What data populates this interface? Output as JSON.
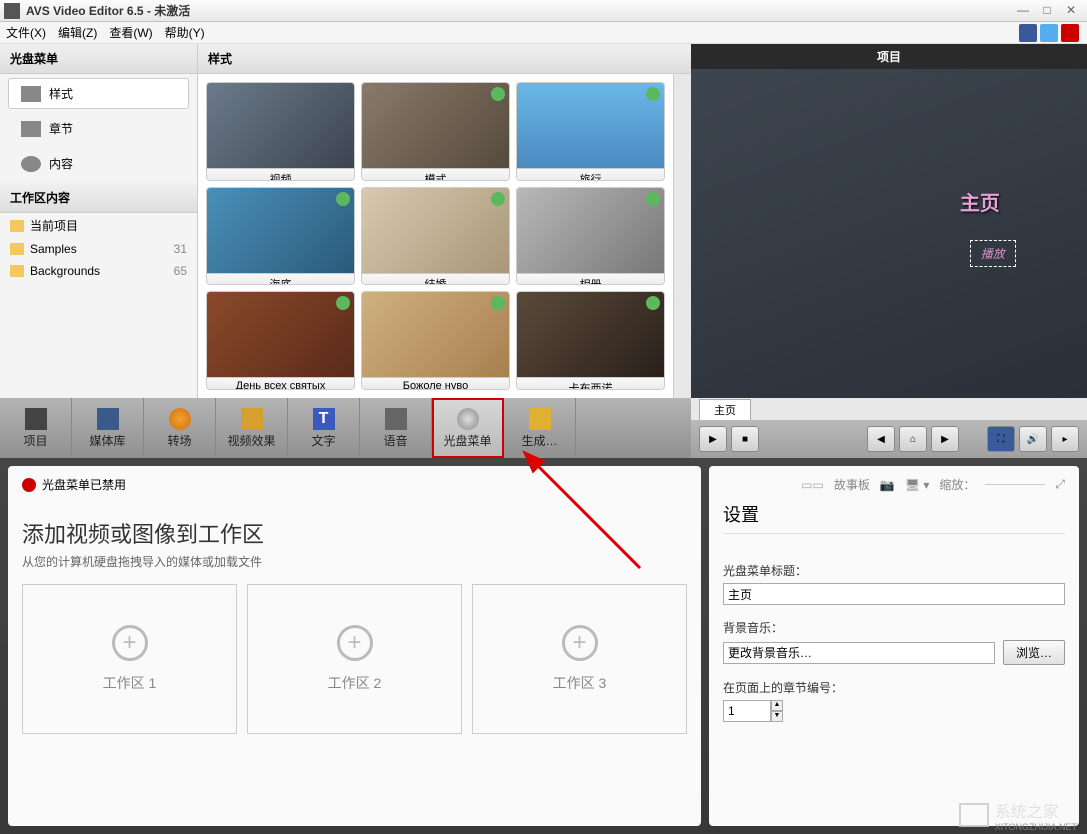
{
  "window": {
    "title": "AVS Video Editor 6.5 - 未激活"
  },
  "menu": {
    "file": "文件(X)",
    "edit": "编辑(Z)",
    "view": "查看(W)",
    "help": "帮助(Y)"
  },
  "leftPanel": {
    "header": "光盘菜单",
    "buttons": {
      "style": "样式",
      "chapter": "章节",
      "content": "内容"
    },
    "workspaceHeader": "工作区内容",
    "folders": [
      {
        "name": "当前项目",
        "count": ""
      },
      {
        "name": "Samples",
        "count": "31"
      },
      {
        "name": "Backgrounds",
        "count": "65"
      }
    ]
  },
  "stylesPanel": {
    "header": "样式",
    "items": [
      "视频",
      "模式",
      "旅行",
      "海底",
      "结婚",
      "相册",
      "День всех святых",
      "Божоле нуво",
      "卡布西诺"
    ]
  },
  "preview": {
    "header": "项目",
    "mainText": "主页",
    "playText": "播放",
    "tab": "主页"
  },
  "toolbar": {
    "project": "项目",
    "media": "媒体库",
    "transition": "转场",
    "videofx": "视频效果",
    "text": "文字",
    "voice": "语音",
    "discmenu": "光盘菜单",
    "produce": "生成…"
  },
  "bottomBar": {
    "disabled": "光盘菜单已禁用",
    "storyboard": "故事板",
    "zoom": "缩放："
  },
  "workarea": {
    "title": "添加视频或图像到工作区",
    "subtitle": "从您的计算机硬盘拖拽导入的媒体或加载文件",
    "zones": [
      "工作区 1",
      "工作区 2",
      "工作区 3"
    ]
  },
  "settings": {
    "title": "设置",
    "titleLabel": "光盘菜单标题：",
    "titleValue": "主页",
    "bgmLabel": "背景音乐：",
    "bgmValue": "更改背景音乐…",
    "browse": "浏览…",
    "chapterLabel": "在页面上的章节编号：",
    "chapterValue": "1"
  },
  "watermark": {
    "text": "系统之家",
    "url": "XITONGZHIJIA.NET"
  }
}
